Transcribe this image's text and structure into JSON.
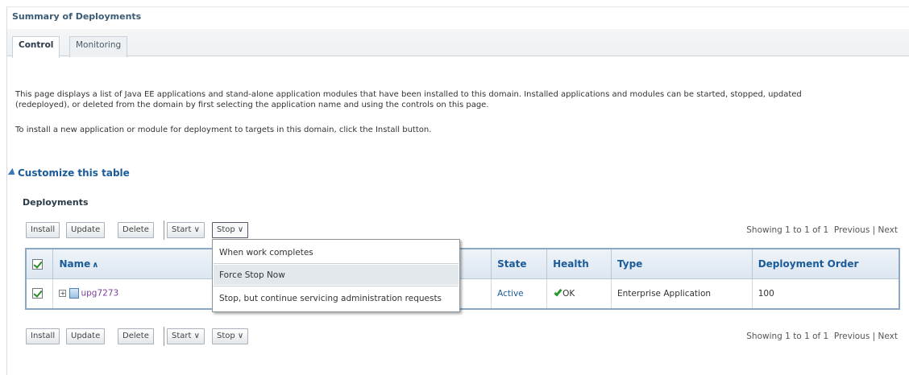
{
  "page": {
    "summary_title": "Summary of Deployments",
    "tabs": [
      {
        "label": "Control",
        "active": true
      },
      {
        "label": "Monitoring",
        "active": false
      }
    ],
    "description_line1": "This page displays a list of Java EE applications and stand-alone application modules that have been installed to this domain. Installed applications and modules can be started, stopped, updated",
    "description_line2": "(redeployed), or deleted from the domain by first selecting the application name and using the controls on this page.",
    "description_line3": "To install a new application or module for deployment to targets in this domain, click the Install button.",
    "customize_link": "Customize this table",
    "section_title": "Deployments"
  },
  "toolbar": {
    "install": "Install",
    "update": "Update",
    "delete": "Delete",
    "start": "Start",
    "stop": "Stop",
    "dropdown_glyph": "∨",
    "paging_text": "Showing 1 to 1 of 1",
    "previous": "Previous",
    "divider": "|",
    "next": "Next"
  },
  "table": {
    "columns": [
      "Name",
      "State",
      "Health",
      "Type",
      "Deployment Order"
    ],
    "rows": [
      {
        "name": "upg7273",
        "state": "Active",
        "health": "OK",
        "type": "Enterprise Application",
        "deployment_order": "100"
      }
    ]
  },
  "stop_menu": {
    "items": [
      "When work completes",
      "Force Stop Now",
      "Stop, but continue servicing administration requests"
    ],
    "highlighted_index": 1
  },
  "colors": {
    "header_blue": "#1a5b99",
    "table_border": "#8ba9c4",
    "app_link": "#7b3d9c",
    "ok_green": "#2b9a2b"
  }
}
